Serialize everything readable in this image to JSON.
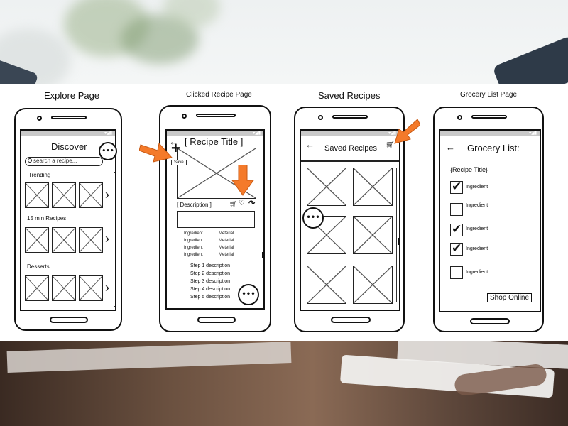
{
  "titles": {
    "explore": "Explore Page",
    "clicked": "Clicked Recipe Page",
    "saved": "Saved Recipes",
    "grocery": "Grocery List Page"
  },
  "explore": {
    "heading": "Discover",
    "search_placeholder": "search a recipe...",
    "menu_dots": "•••",
    "sections": [
      "Trending",
      "15 min Recipes",
      "Desserts"
    ],
    "chevron": "›"
  },
  "clicked": {
    "back": "←",
    "title": "[ Recipe Title ]",
    "save_tooltip": "Save",
    "plus": "+",
    "description_label": "[ Description ]",
    "ingredients": [
      {
        "name": "Ingredient",
        "material": "Meterial"
      },
      {
        "name": "Ingredient",
        "material": "Meterial"
      },
      {
        "name": "Ingredient",
        "material": "Meterial"
      },
      {
        "name": "Ingredient",
        "material": "Meterial"
      }
    ],
    "steps": [
      "Step 1 description",
      "Step 2 description",
      "Step 3 description",
      "Step 4 description",
      "Step 5 description"
    ],
    "menu_dots": "•••"
  },
  "saved": {
    "back": "←",
    "heading": "Saved Recipes",
    "menu_dots": "•••"
  },
  "grocery": {
    "back": "←",
    "heading": "Grocery List:",
    "recipe_title": "{Recipe Title}",
    "items": [
      {
        "label": "Ingredient",
        "checked": true
      },
      {
        "label": "Ingredient",
        "checked": false
      },
      {
        "label": "Ingredient",
        "checked": true
      },
      {
        "label": "Ingredient",
        "checked": true
      },
      {
        "label": "Ingredient",
        "checked": false
      }
    ],
    "shop_button": "Shop Online"
  },
  "status_icons": "▾◢▮",
  "accent_color": "#f47a2a"
}
